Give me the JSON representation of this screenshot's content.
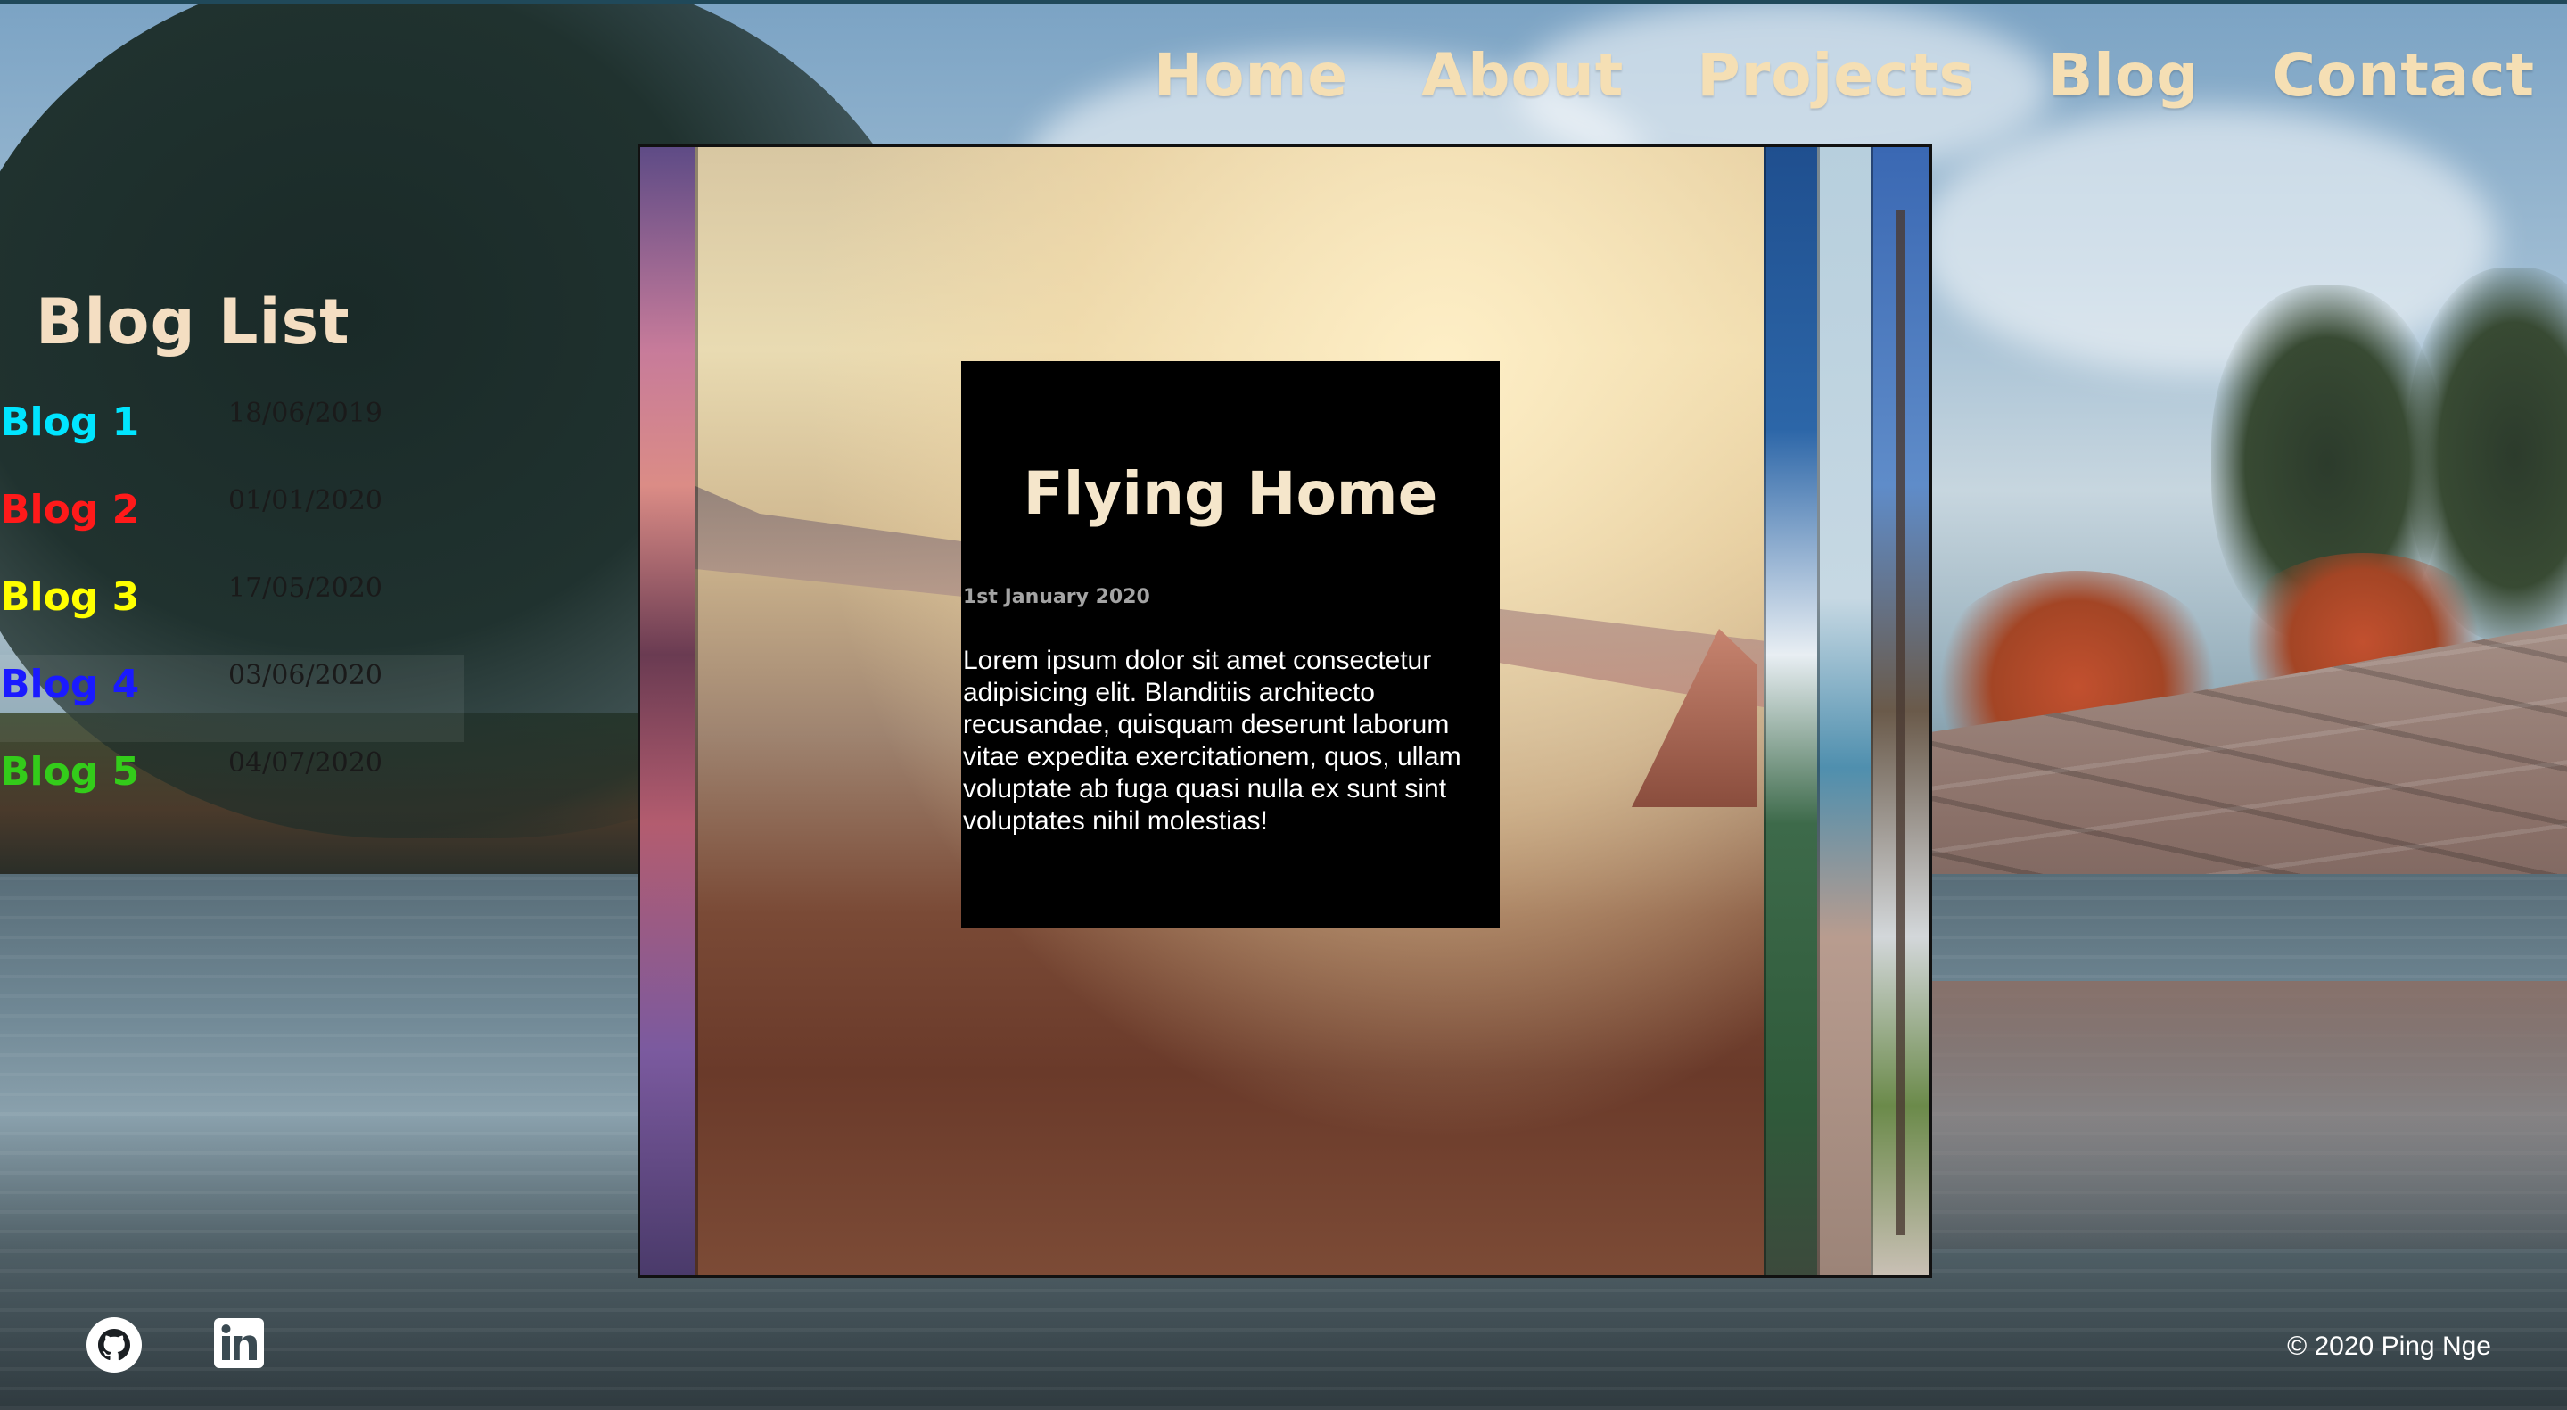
{
  "nav": {
    "items": [
      {
        "label": "Home"
      },
      {
        "label": "About"
      },
      {
        "label": "Projects"
      },
      {
        "label": "Blog"
      },
      {
        "label": "Contact"
      }
    ]
  },
  "sidebar": {
    "title": "Blog List",
    "items": [
      {
        "label": "Blog 1",
        "date": "18/06/2019",
        "color": "#00e5ff"
      },
      {
        "label": "Blog 2",
        "date": "01/01/2020",
        "color": "#ff1a1a"
      },
      {
        "label": "Blog 3",
        "date": "17/05/2020",
        "color": "#ffff00"
      },
      {
        "label": "Blog 4",
        "date": "03/06/2020",
        "color": "#1a1aff"
      },
      {
        "label": "Blog 5",
        "date": "04/07/2020",
        "color": "#33cc1a"
      }
    ]
  },
  "post": {
    "title": "Flying Home",
    "date": "1st January 2020",
    "body": "Lorem ipsum dolor sit amet consectetur adipisicing elit. Blanditiis architecto recusandae, quisquam deserunt laborum vitae expedita exercitationem, quos, ullam voluptate ab fuga quasi nulla ex sunt sint voluptates nihil molestias!"
  },
  "footer": {
    "social": [
      {
        "icon": "github-icon"
      },
      {
        "icon": "linkedin-icon"
      }
    ],
    "copyright": "© 2020 Ping Nge"
  },
  "colors": {
    "nav_text": "#f5dfb4",
    "card_bg": "#000000",
    "post_title": "#f5e6cb"
  }
}
